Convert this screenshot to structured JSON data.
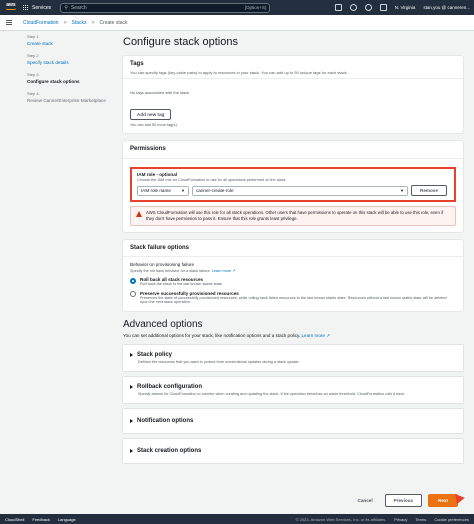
{
  "topnav": {
    "logo": "aws",
    "services_label": "Services",
    "search_placeholder": "Search",
    "search_shortcut": "[Option+S]",
    "region": "N. Virginia",
    "account": "stan.you @ canneren..."
  },
  "breadcrumb": {
    "items": [
      "CloudFormation",
      "Stacks",
      "Create stack"
    ],
    "separator": ">"
  },
  "steps": [
    {
      "num": "Step 1",
      "label": "Create stack"
    },
    {
      "num": "Step 2",
      "label": "Specify stack details"
    },
    {
      "num": "Step 3",
      "label": "Configure stack options"
    },
    {
      "num": "Step 4",
      "label": "Review CannerEnterprise-Marketplace"
    }
  ],
  "page_title": "Configure stack options",
  "tags": {
    "title": "Tags",
    "desc": "You can specify tags (key-value pairs) to apply to resources in your stack. You can add up to 50 unique tags for each stack.",
    "empty": "No tags associated with the stack.",
    "add_button": "Add new tag",
    "hint": "You can add 50 more tag(s)."
  },
  "permissions": {
    "title": "Permissions",
    "iam_label": "IAM role - optional",
    "iam_desc": "Choose the IAM role for CloudFormation to use for all operations performed on the stack.",
    "iam_type": "IAM role name",
    "iam_value": "canner-create-role",
    "remove_button": "Remove",
    "warning": "AWS CloudFormation will use this role for all stack operations. Other users that have permissions to operate on this stack will be able to use this role, even if they don't have permission to pass it. Ensure that this role grants least privilege."
  },
  "failure": {
    "title": "Stack failure options",
    "behavior_label": "Behavior on provisioning failure",
    "behavior_desc": "Specify the roll back behavior for a stack failure.",
    "learn_more": "Learn more",
    "opt1_title": "Roll back all stack resources",
    "opt1_desc": "Roll back the stack to the last known stable state.",
    "opt2_title": "Preserve successfully provisioned resources",
    "opt2_desc": "Preserves the state of successfully provisioned resources, while rolling back failed resources to the last known stable state. Resources without a last known stable state will be deleted upon the next stack operation."
  },
  "advanced": {
    "title": "Advanced options",
    "desc": "You can set additional options for your stack, like notification options and a stack policy.",
    "learn_more": "Learn more",
    "sections": [
      {
        "title": "Stack policy",
        "desc": "Defines the resources that you want to protect from unintentional updates during a stack update."
      },
      {
        "title": "Rollback configuration",
        "desc": "Specify alarms for CloudFormation to monitor when creating and updating the stack. If the operation breaches an alarm threshold, CloudFormation rolls it back."
      },
      {
        "title": "Notification options",
        "desc": ""
      },
      {
        "title": "Stack creation options",
        "desc": ""
      }
    ]
  },
  "actions": {
    "cancel": "Cancel",
    "previous": "Previous",
    "next": "Next"
  },
  "footer": {
    "cloudshell": "CloudShell",
    "feedback": "Feedback",
    "language": "Language",
    "copyright": "© 2023, Amazon Web Services, Inc. or its affiliates.",
    "privacy": "Privacy",
    "terms": "Terms",
    "cookie": "Cookie preferences"
  },
  "colors": {
    "highlight": "#e8412d",
    "primary": "#ec7211",
    "link": "#0073bb",
    "nav": "#232f3e"
  }
}
